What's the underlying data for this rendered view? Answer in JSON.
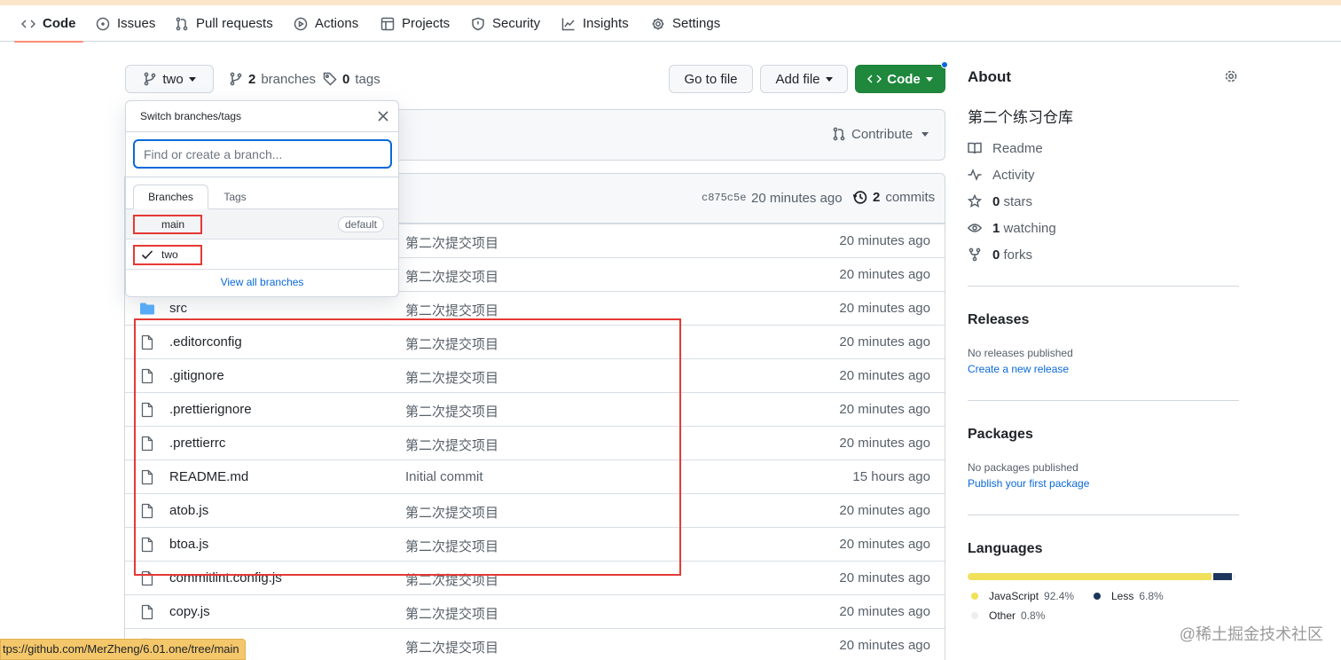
{
  "nav": {
    "code": "Code",
    "issues": "Issues",
    "pulls": "Pull requests",
    "actions": "Actions",
    "projects": "Projects",
    "security": "Security",
    "insights": "Insights",
    "settings": "Settings"
  },
  "toolbar": {
    "branch": "two",
    "branches_count": "2",
    "branches_label": "branches",
    "tags_count": "0",
    "tags_label": "tags",
    "go_to_file": "Go to file",
    "add_file": "Add file",
    "code": "Code"
  },
  "contribute": "Contribute",
  "commit_header": {
    "sha": "c875c5e",
    "time": "20 minutes ago",
    "commits_count": "2",
    "commits_label": "commits"
  },
  "files": [
    {
      "name": "",
      "type": "dir",
      "message": "第二次提交项目",
      "time": "20 minutes ago"
    },
    {
      "name": "",
      "type": "dir",
      "message": "第二次提交项目",
      "time": "20 minutes ago"
    },
    {
      "name": "src",
      "type": "dir",
      "message": "第二次提交项目",
      "time": "20 minutes ago"
    },
    {
      "name": ".editorconfig",
      "type": "file",
      "message": "第二次提交项目",
      "time": "20 minutes ago"
    },
    {
      "name": ".gitignore",
      "type": "file",
      "message": "第二次提交项目",
      "time": "20 minutes ago"
    },
    {
      "name": ".prettierignore",
      "type": "file",
      "message": "第二次提交项目",
      "time": "20 minutes ago"
    },
    {
      "name": ".prettierrc",
      "type": "file",
      "message": "第二次提交项目",
      "time": "20 minutes ago"
    },
    {
      "name": "README.md",
      "type": "file",
      "message": "Initial commit",
      "time": "15 hours ago"
    },
    {
      "name": "atob.js",
      "type": "file",
      "message": "第二次提交项目",
      "time": "20 minutes ago"
    },
    {
      "name": "btoa.js",
      "type": "file",
      "message": "第二次提交项目",
      "time": "20 minutes ago"
    },
    {
      "name": "commitlint.config.js",
      "type": "file",
      "message": "第二次提交项目",
      "time": "20 minutes ago"
    },
    {
      "name": "copy.js",
      "type": "file",
      "message": "第二次提交项目",
      "time": "20 minutes ago"
    },
    {
      "name": "",
      "type": "file",
      "message": "第二次提交项目",
      "time": "20 minutes ago"
    }
  ],
  "dropdown": {
    "title": "Switch branches/tags",
    "placeholder": "Find or create a branch...",
    "tab_branches": "Branches",
    "tab_tags": "Tags",
    "branches": [
      {
        "name": "main",
        "badge": "default",
        "selected": false
      },
      {
        "name": "two",
        "badge": "",
        "selected": true
      }
    ],
    "view_all": "View all branches"
  },
  "about": {
    "title": "About",
    "description": "第二个练习仓库",
    "readme": "Readme",
    "activity": "Activity",
    "stars_count": "0",
    "stars_label": "stars",
    "watching_count": "1",
    "watching_label": "watching",
    "forks_count": "0",
    "forks_label": "forks"
  },
  "releases": {
    "title": "Releases",
    "empty": "No releases published",
    "link": "Create a new release"
  },
  "packages": {
    "title": "Packages",
    "empty": "No packages published",
    "link": "Publish your first package"
  },
  "languages": {
    "title": "Languages",
    "items": [
      {
        "name": "JavaScript",
        "percent": "92.4%",
        "value": 92.4,
        "color": "#f1e05a"
      },
      {
        "name": "Less",
        "percent": "6.8%",
        "value": 6.8,
        "color": "#1d365d"
      },
      {
        "name": "Other",
        "percent": "0.8%",
        "value": 0.8,
        "color": "#ededed"
      }
    ]
  },
  "status_url": "tps://github.com/MerZheng/6.01.one/tree/main",
  "watermark": "@稀土掘金技术社区"
}
